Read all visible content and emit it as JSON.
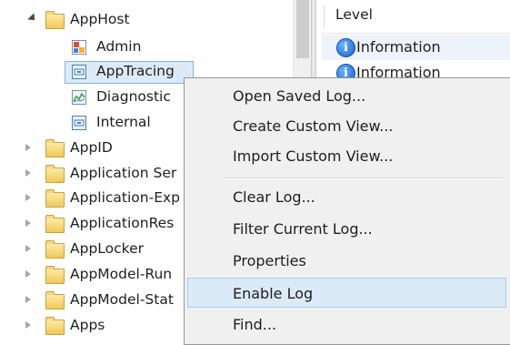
{
  "tree": {
    "items": [
      {
        "label": "AppHost",
        "expanded": true,
        "icon": "folder-icon",
        "level": 0
      },
      {
        "label": "Admin",
        "icon": "admin-log-icon",
        "level": 1
      },
      {
        "label": "AppTracing",
        "icon": "log-icon",
        "level": 1,
        "selected": true
      },
      {
        "label": "Diagnostic",
        "icon": "diagnostic-log-icon",
        "level": 1
      },
      {
        "label": "Internal",
        "icon": "log-icon",
        "level": 1
      },
      {
        "label": "AppID",
        "icon": "folder-icon",
        "level": 0
      },
      {
        "label": "Application Ser",
        "icon": "folder-icon",
        "level": 0
      },
      {
        "label": "Application-Exp",
        "icon": "folder-icon",
        "level": 0
      },
      {
        "label": "ApplicationRes",
        "icon": "folder-icon",
        "level": 0
      },
      {
        "label": "AppLocker",
        "icon": "folder-icon",
        "level": 0
      },
      {
        "label": "AppModel-Run",
        "icon": "folder-icon",
        "level": 0
      },
      {
        "label": "AppModel-Stat",
        "icon": "folder-icon",
        "level": 0
      },
      {
        "label": "Apps",
        "icon": "folder-icon",
        "level": 0
      }
    ]
  },
  "events": {
    "column_header": "Level",
    "rows": [
      {
        "level": "Information",
        "icon": "info-icon"
      },
      {
        "level": "Information",
        "icon": "info-icon"
      }
    ]
  },
  "context_menu": {
    "groups": [
      [
        "Open Saved Log...",
        "Create Custom View...",
        "Import Custom View..."
      ],
      [
        "Clear Log...",
        "Filter Current Log...",
        "Properties",
        "Enable Log",
        "Find..."
      ]
    ],
    "highlighted": "Enable Log"
  },
  "colors": {
    "selection": "#dceaf7",
    "selection_border": "#7eb4ea",
    "menu_background": "#f0f0f0",
    "info_blue": "#1663c7"
  }
}
